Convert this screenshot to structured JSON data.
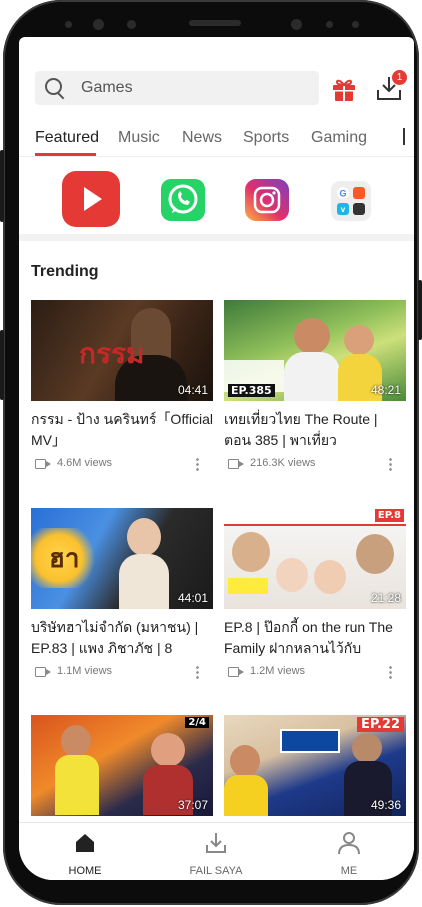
{
  "search": {
    "placeholder": "Games"
  },
  "header": {
    "notification_count": "1"
  },
  "tabs": [
    {
      "label": "Featured",
      "active": true
    },
    {
      "label": "Music",
      "active": false
    },
    {
      "label": "News",
      "active": false
    },
    {
      "label": "Sports",
      "active": false
    },
    {
      "label": "Gaming",
      "active": false
    }
  ],
  "apps": [
    {
      "icon": "youtube-icon",
      "color": "#e53935"
    },
    {
      "icon": "whatsapp-icon",
      "color": "#25d366"
    },
    {
      "icon": "instagram-icon",
      "color": "#d6249f"
    },
    {
      "icon": "apps-folder-icon",
      "color": "#eeeeee"
    }
  ],
  "trending": {
    "title": "Trending",
    "videos": [
      {
        "title": "กรรม - ป้าง นครินทร์「Official MV」",
        "views": "4.6M views",
        "duration": "04:41",
        "thumb_text": "กรรม"
      },
      {
        "title": "เทยเที่ยวไทย The Route | ตอน 385 | พาเที่ยว",
        "views": "216.3K views",
        "duration": "48:21",
        "thumb_text": "EP.385"
      },
      {
        "title": "บริษัทฮาไม่จำกัด (มหาชน) | EP.83 | แพง ภิชาภัช | 8",
        "views": "1.1M views",
        "duration": "44:01",
        "thumb_text": "ฮา"
      },
      {
        "title": "EP.8 | ป๊อกกี้ on the run The Family ฝากหลานไว้กับ",
        "views": "1.2M views",
        "duration": "21:28",
        "thumb_text": "EP.8"
      },
      {
        "title": "",
        "views": "",
        "duration": "37:07",
        "thumb_text": "2/4"
      },
      {
        "title": "",
        "views": "",
        "duration": "49:36",
        "thumb_text": "EP.22"
      }
    ]
  },
  "bottom_nav": [
    {
      "label": "HOME",
      "icon": "home-icon",
      "active": true
    },
    {
      "label": "FAIL SAYA",
      "icon": "download-icon",
      "active": false
    },
    {
      "label": "ME",
      "icon": "person-icon",
      "active": false
    }
  ],
  "colors": {
    "accent": "#e53935"
  }
}
